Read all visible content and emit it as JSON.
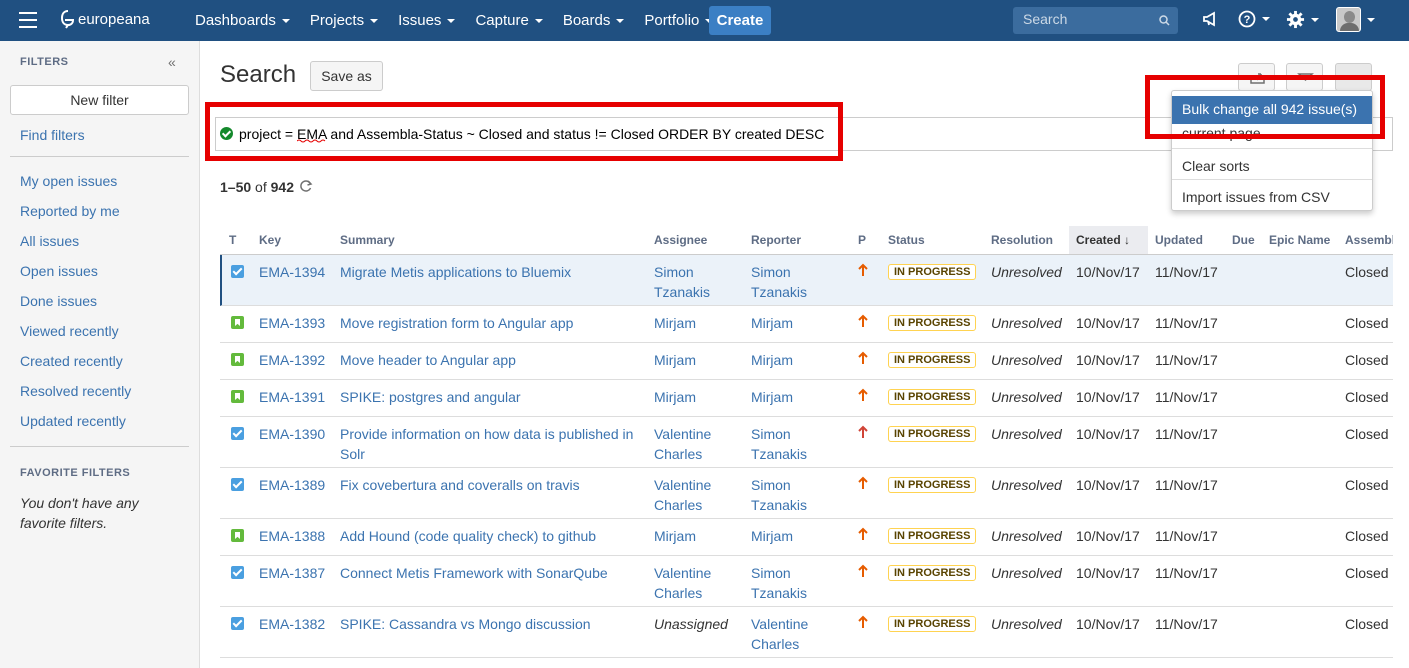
{
  "topbar": {
    "logo_text": "europeana",
    "nav": [
      "Dashboards",
      "Projects",
      "Issues",
      "Capture",
      "Boards",
      "Portfolio"
    ],
    "create_label": "Create",
    "search_placeholder": "Search"
  },
  "sidebar": {
    "filters_heading": "FILTERS",
    "new_filter_label": "New filter",
    "find_filters_label": "Find filters",
    "links": [
      "My open issues",
      "Reported by me",
      "All issues",
      "Open issues",
      "Done issues",
      "Viewed recently",
      "Created recently",
      "Resolved recently",
      "Updated recently"
    ],
    "favorites_heading": "FAVORITE FILTERS",
    "favorites_empty": "You don't have any favorite filters."
  },
  "main": {
    "title": "Search",
    "save_as_label": "Save as",
    "jql": "project = EMA and Assembla-Status ~ Closed and status != Closed ORDER BY created DESC",
    "count_prefix": "1–50",
    "count_of": "of",
    "count_total": "942"
  },
  "dropdown": {
    "items": [
      "Bulk change all 942 issue(s)",
      "current page",
      "Clear sorts",
      "Import issues from CSV"
    ]
  },
  "table": {
    "headers": [
      "T",
      "Key",
      "Summary",
      "Assignee",
      "Reporter",
      "P",
      "Status",
      "Resolution",
      "Created",
      "Updated",
      "Due",
      "Epic Name",
      "Assembla"
    ],
    "rows": [
      {
        "type": "task",
        "key": "EMA-1394",
        "summary": "Migrate Metis applications to Bluemix",
        "assignee": "Simon Tzanakis",
        "reporter": "Simon Tzanakis",
        "priority_color": "#e65c00",
        "status": "IN PROGRESS",
        "resolution": "Unresolved",
        "created": "10/Nov/17",
        "updated": "11/Nov/17",
        "assembla": "Closed",
        "selected": true
      },
      {
        "type": "story",
        "key": "EMA-1393",
        "summary": "Move registration form to Angular app",
        "assignee": "Mirjam",
        "reporter": "Mirjam",
        "priority_color": "#e65c00",
        "status": "IN PROGRESS",
        "resolution": "Unresolved",
        "created": "10/Nov/17",
        "updated": "11/Nov/17",
        "assembla": "Closed"
      },
      {
        "type": "story",
        "key": "EMA-1392",
        "summary": "Move header to Angular app",
        "assignee": "Mirjam",
        "reporter": "Mirjam",
        "priority_color": "#e65c00",
        "status": "IN PROGRESS",
        "resolution": "Unresolved",
        "created": "10/Nov/17",
        "updated": "11/Nov/17",
        "assembla": "Closed"
      },
      {
        "type": "story",
        "key": "EMA-1391",
        "summary": "SPIKE: postgres and angular",
        "assignee": "Mirjam",
        "reporter": "Mirjam",
        "priority_color": "#e65c00",
        "status": "IN PROGRESS",
        "resolution": "Unresolved",
        "created": "10/Nov/17",
        "updated": "11/Nov/17",
        "assembla": "Closed"
      },
      {
        "type": "task",
        "key": "EMA-1390",
        "summary": "Provide information on how data is published in Solr",
        "assignee": "Valentine Charles",
        "reporter": "Simon Tzanakis",
        "priority_color": "#d04437",
        "status": "IN PROGRESS",
        "resolution": "Unresolved",
        "created": "10/Nov/17",
        "updated": "11/Nov/17",
        "assembla": "Closed"
      },
      {
        "type": "task",
        "key": "EMA-1389",
        "summary": "Fix covebertura and coveralls on travis",
        "assignee": "Valentine Charles",
        "reporter": "Simon Tzanakis",
        "priority_color": "#e65c00",
        "status": "IN PROGRESS",
        "resolution": "Unresolved",
        "created": "10/Nov/17",
        "updated": "11/Nov/17",
        "assembla": "Closed"
      },
      {
        "type": "story",
        "key": "EMA-1388",
        "summary": "Add Hound (code quality check) to github",
        "assignee": "Mirjam",
        "reporter": "Mirjam",
        "priority_color": "#e65c00",
        "status": "IN PROGRESS",
        "resolution": "Unresolved",
        "created": "10/Nov/17",
        "updated": "11/Nov/17",
        "assembla": "Closed"
      },
      {
        "type": "task",
        "key": "EMA-1387",
        "summary": "Connect Metis Framework with SonarQube",
        "assignee": "Valentine Charles",
        "reporter": "Simon Tzanakis",
        "priority_color": "#e65c00",
        "status": "IN PROGRESS",
        "resolution": "Unresolved",
        "created": "10/Nov/17",
        "updated": "11/Nov/17",
        "assembla": "Closed"
      },
      {
        "type": "task",
        "key": "EMA-1382",
        "summary": "SPIKE: Cassandra vs Mongo discussion",
        "assignee": "Unassigned",
        "reporter": "Valentine Charles",
        "priority_color": "#e65c00",
        "status": "IN PROGRESS",
        "resolution": "Unresolved",
        "created": "10/Nov/17",
        "updated": "11/Nov/17",
        "assembla": "Closed",
        "assignee_italic": true
      }
    ]
  }
}
